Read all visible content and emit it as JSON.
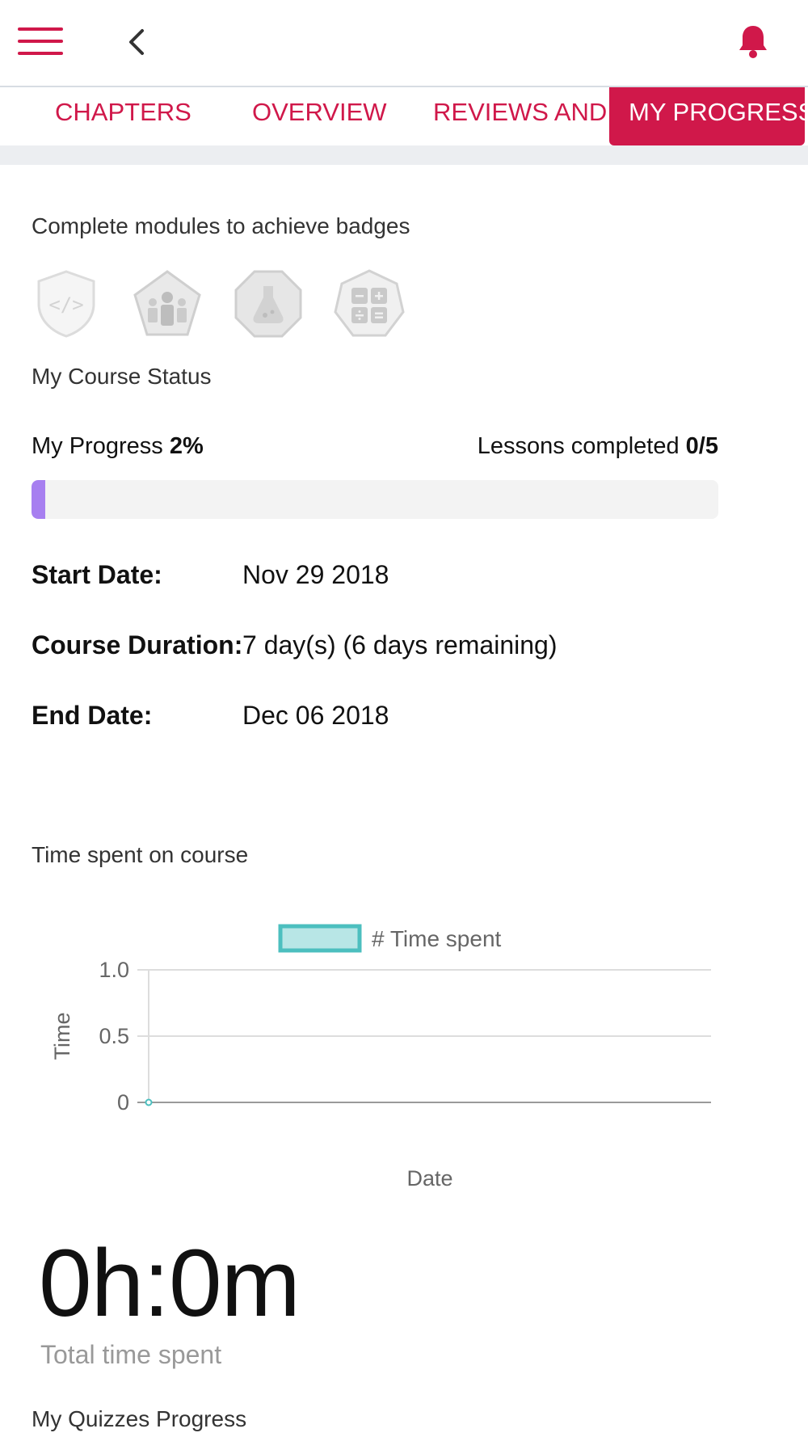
{
  "header": {
    "menu_icon": "hamburger-menu-icon",
    "back_icon": "chevron-left-icon",
    "notification_icon": "bell-icon"
  },
  "tabs": [
    {
      "label": "CHAPTERS"
    },
    {
      "label": "OVERVIEW"
    },
    {
      "label": "REVIEWS AND"
    },
    {
      "label": "MY PROGRESS"
    }
  ],
  "badges": {
    "title": "Complete modules to achieve badges",
    "items": [
      {
        "icon": "code-shield-icon"
      },
      {
        "icon": "group-pentagon-icon"
      },
      {
        "icon": "flask-octagon-icon"
      },
      {
        "icon": "calculator-heptagon-icon"
      }
    ]
  },
  "status": {
    "title": "My Course Status",
    "progress_label": "My Progress",
    "progress_value": "2%",
    "progress_fraction": 0.02,
    "lessons_label": "Lessons completed",
    "lessons_value": "0/5"
  },
  "course_info": {
    "start_label": "Start Date:",
    "start_value": "Nov 29 2018",
    "duration_label": "Course Duration:",
    "duration_value": "7 day(s) (6 days remaining)",
    "end_label": "End Date:",
    "end_value": "Dec 06 2018"
  },
  "time_section": {
    "title": "Time spent on course",
    "total_value": "0h:0m",
    "total_caption": "Total time spent"
  },
  "quizzes": {
    "title": "My Quizzes Progress"
  },
  "colors": {
    "brand": "#d0184a",
    "progress_fill": "#a77ff0",
    "chart_series": "#4cbfbf"
  },
  "chart_data": {
    "type": "line",
    "legend": [
      "# Time spent"
    ],
    "xlabel": "Date",
    "ylabel": "Time",
    "ylim": [
      0,
      1.0
    ],
    "yticks": [
      "0",
      "0.5",
      "1.0"
    ],
    "series": [
      {
        "name": "# Time spent",
        "values": [
          0
        ]
      }
    ],
    "x": [
      ""
    ],
    "grid": true,
    "legend_position": "top"
  }
}
